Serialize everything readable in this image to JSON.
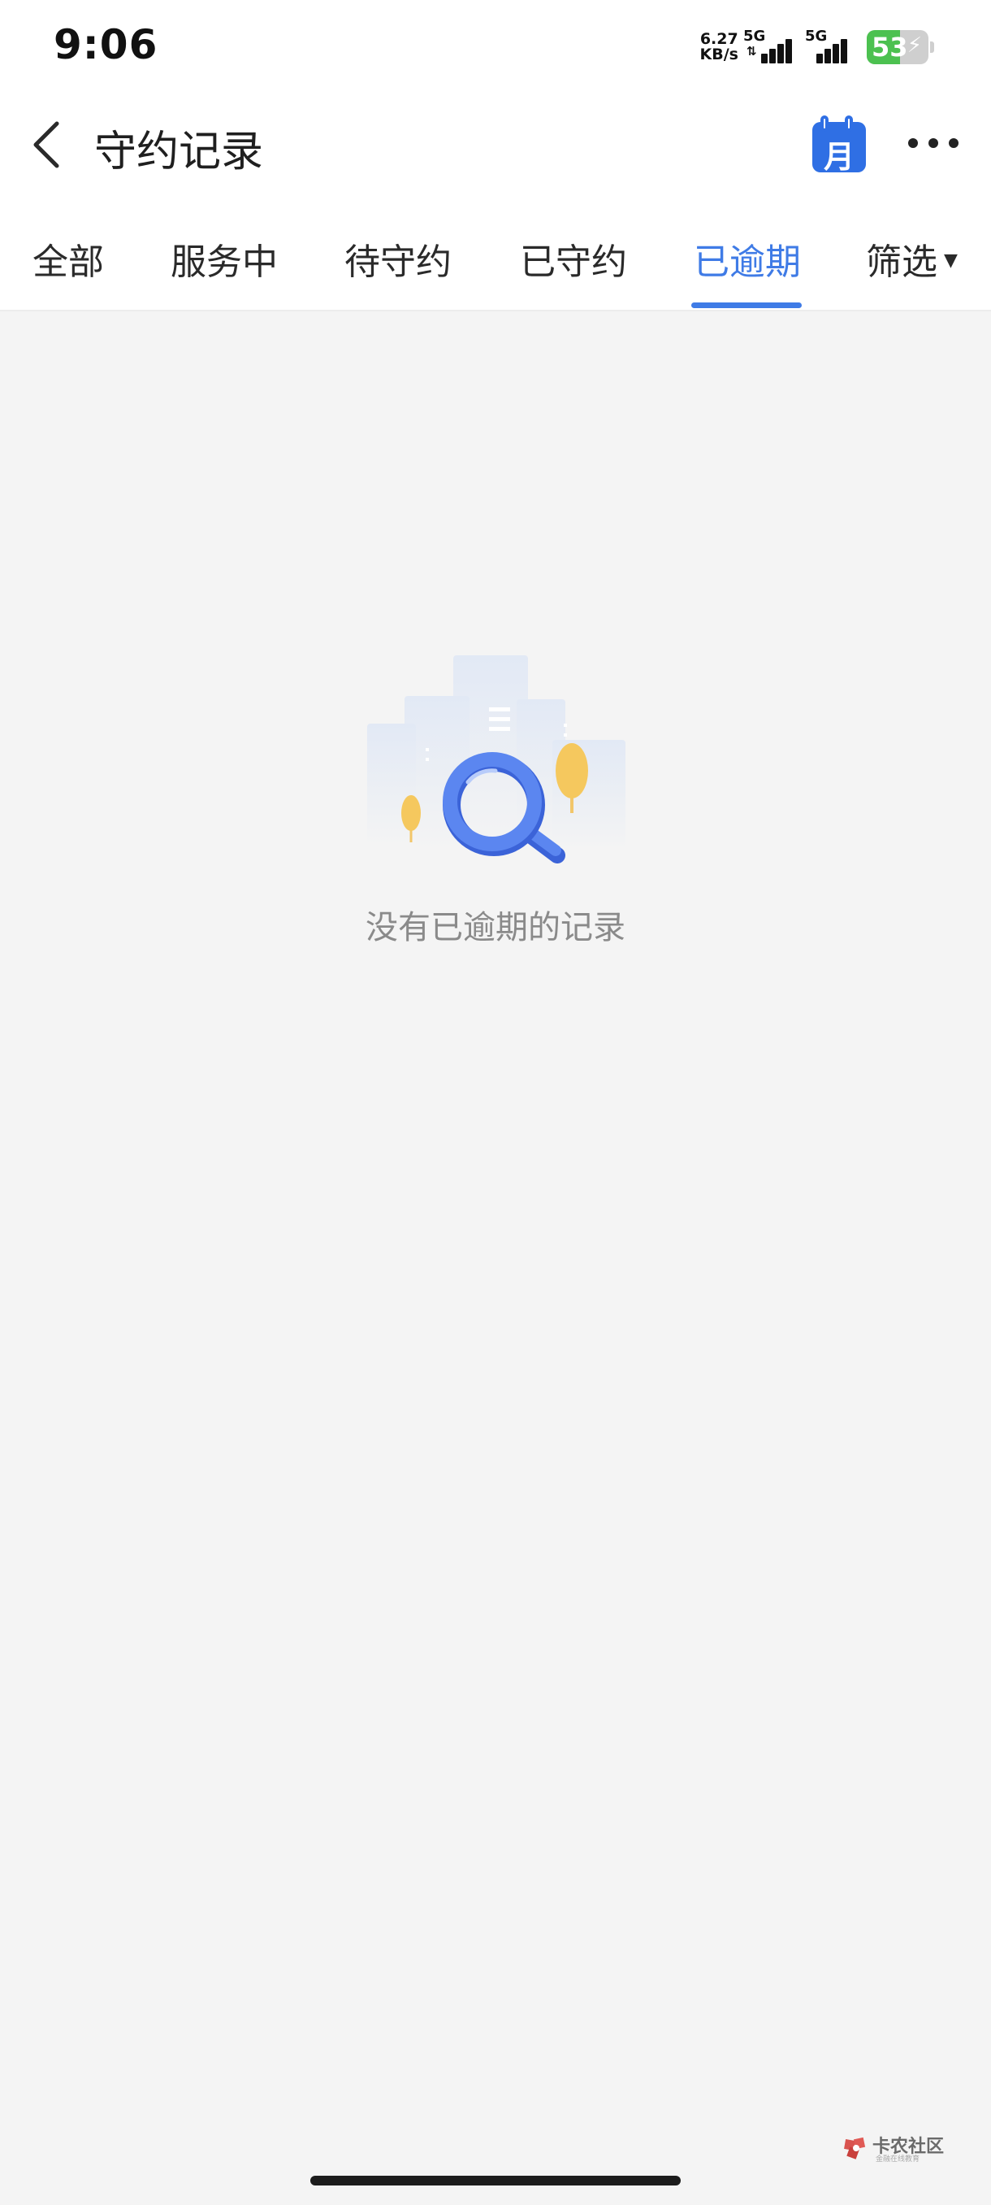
{
  "status_bar": {
    "time": "9:06",
    "net_speed_value": "6.27",
    "net_speed_unit": "KB/s",
    "sim1_label": "5G",
    "sim2_label": "5G",
    "battery_level": "53",
    "battery_charging": true,
    "battery_color": "#4cc150"
  },
  "nav": {
    "back_icon": "chevron-left-icon",
    "title": "守约记录",
    "calendar_label": "月",
    "calendar_color": "#2f6fe4",
    "more_icon": "more-horizontal-icon"
  },
  "tabs": [
    {
      "label": "全部",
      "active": false
    },
    {
      "label": "服务中",
      "active": false
    },
    {
      "label": "待守约",
      "active": false
    },
    {
      "label": "已守约",
      "active": false
    },
    {
      "label": "已逾期",
      "active": true
    },
    {
      "label": "筛选",
      "active": false,
      "dropdown": true
    }
  ],
  "accent_color": "#3f7be6",
  "empty_state": {
    "icon": "magnifier-city-illustration",
    "message": "没有已逾期的记录"
  },
  "watermark": {
    "title": "卡农社区",
    "subtitle": "金融在线教育"
  }
}
